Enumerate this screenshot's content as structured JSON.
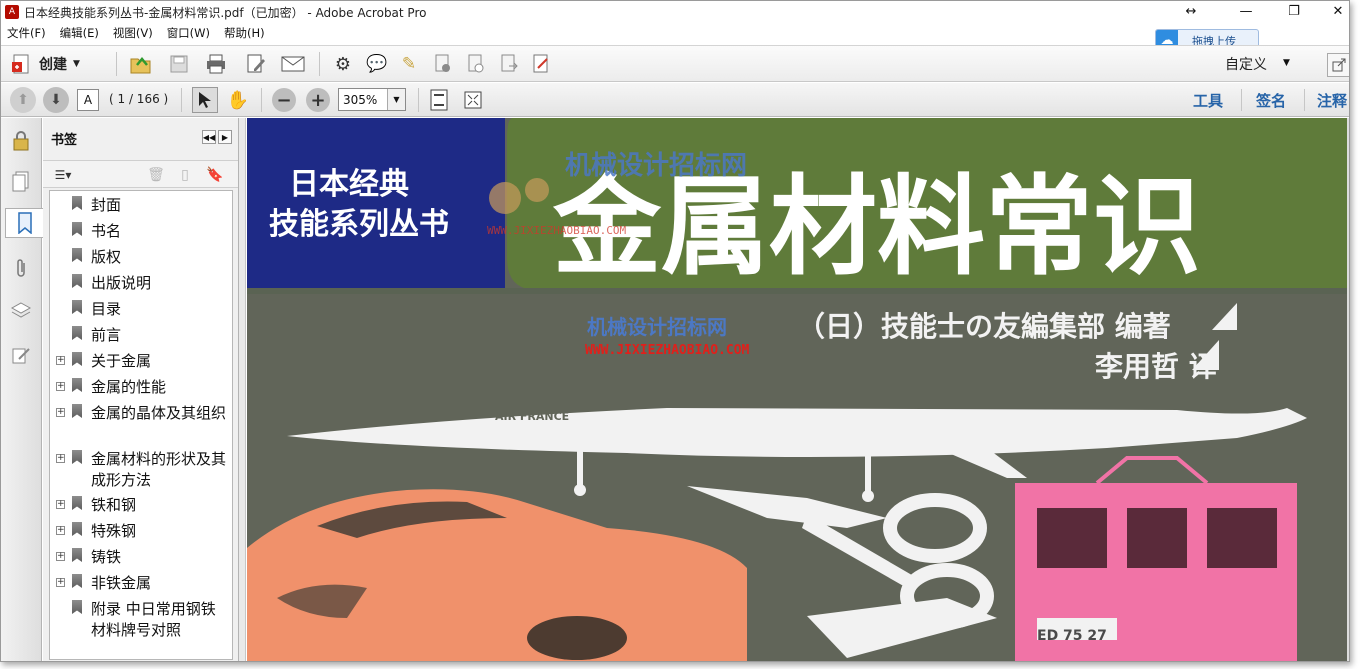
{
  "window": {
    "title": "日本经典技能系列丛书-金属材料常识.pdf（已加密） - Adobe Acrobat Pro",
    "resize_glyph": "↔",
    "minimize": "—",
    "restore": "❐",
    "close": "✕"
  },
  "menu": [
    "文件(F)",
    "编辑(E)",
    "视图(V)",
    "窗口(W)",
    "帮助(H)"
  ],
  "upload_button": "拖拽上传",
  "toolbar": {
    "create_label": "创建",
    "custom_label": "自定义"
  },
  "nav": {
    "page_input": "A",
    "page_count": "( 1 / 166 )",
    "zoom": "305%"
  },
  "right_links": [
    "工具",
    "签名",
    "注释"
  ],
  "bookmarks": {
    "title": "书签",
    "items": [
      {
        "label": "封面",
        "expandable": false
      },
      {
        "label": "书名",
        "expandable": false
      },
      {
        "label": "版权",
        "expandable": false
      },
      {
        "label": "出版说明",
        "expandable": false
      },
      {
        "label": "目录",
        "expandable": false
      },
      {
        "label": "前言",
        "expandable": false
      },
      {
        "label": "关于金属",
        "expandable": true
      },
      {
        "label": "金属的性能",
        "expandable": true
      },
      {
        "label": "金属的晶体及其组织",
        "expandable": true
      },
      {
        "label": "金属材料的形状及其成形方法",
        "expandable": true
      },
      {
        "label": "铁和钢",
        "expandable": true
      },
      {
        "label": "特殊钢",
        "expandable": true
      },
      {
        "label": "铸铁",
        "expandable": true
      },
      {
        "label": "非铁金属",
        "expandable": true
      },
      {
        "label": "附录 中日常用钢铁材料牌号对照",
        "expandable": false
      }
    ]
  },
  "cover": {
    "series_line1": "日本经典",
    "series_line2": "技能系列丛书",
    "book_title": "金属材料常识",
    "author": "（日）技能士の友編集部 编著",
    "translator": "李用哲 译",
    "watermark_cn": "机械设计招标网",
    "watermark_url": "WWW.JIXIEZHAOBIAO.COM",
    "plane_text": "AIR FRANCE",
    "train_text": "ED 75 27"
  },
  "colors": {
    "cover_blue": "#1e2a86",
    "cover_green": "#5f7b3a",
    "cover_gray": "#616559",
    "car_orange": "#f0916b",
    "train_pink": "#f173a6",
    "link_blue": "#2764a8"
  }
}
